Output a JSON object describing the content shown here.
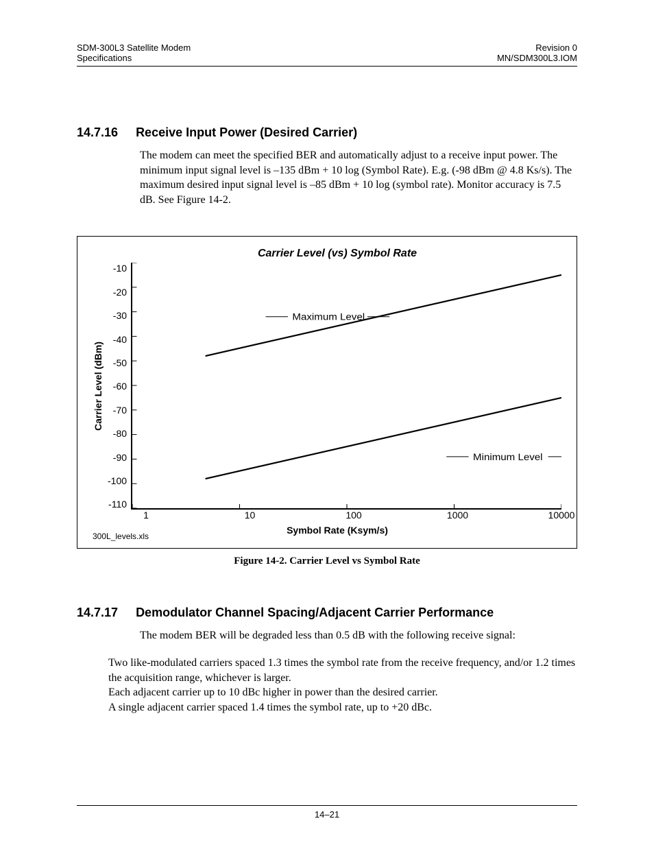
{
  "header": {
    "left_line1": "SDM-300L3 Satellite Modem",
    "left_line2": "Specifications",
    "right_line1": "Revision 0",
    "right_line2": "MN/SDM300L3.IOM"
  },
  "section1": {
    "num": "14.7.16",
    "title": "Receive Input Power (Desired Carrier)",
    "body": "The modem can meet the specified BER and automatically adjust to a receive input power. The minimum input signal level is –135 dBm + 10 log (Symbol Rate). E.g. (-98 dBm @ 4.8 Ks/s). The maximum desired input signal level is –85 dBm + 10 log (symbol rate). Monitor accuracy is   7.5 dB. See Figure 14-2."
  },
  "chart_data": {
    "type": "line",
    "title": "Carrier Level (vs) Symbol Rate",
    "xlabel": "Symbol Rate (Ksym/s)",
    "ylabel": "Carrier Level (dBm)",
    "x_ticks": [
      1,
      10,
      100,
      1000,
      10000
    ],
    "y_ticks": [
      -10,
      -20,
      -30,
      -40,
      -50,
      -60,
      -70,
      -80,
      -90,
      -100,
      -110
    ],
    "x_scale": "log",
    "xlim": [
      1,
      10000
    ],
    "ylim": [
      -110,
      -10
    ],
    "series": [
      {
        "name": "Maximum Level",
        "x": [
          4.8,
          10000
        ],
        "y": [
          -48,
          -15
        ]
      },
      {
        "name": "Minimum Level",
        "x": [
          4.8,
          10000
        ],
        "y": [
          -98,
          -65
        ]
      }
    ],
    "annotations": [
      {
        "text": "Maximum Level",
        "x": 31,
        "y": -32
      },
      {
        "text": "Minimum Level",
        "x": 1500,
        "y": -89
      }
    ],
    "source_file": "300L_levels.xls"
  },
  "figure_caption": "Figure 14-2.  Carrier Level vs Symbol Rate",
  "section2": {
    "num": "14.7.17",
    "title": "Demodulator Channel Spacing/Adjacent Carrier Performance",
    "lead": "The modem BER will be degraded less than 0.5 dB with the following receive signal:",
    "items": [
      "Two like-modulated carriers spaced 1.3 times the symbol rate from the receive frequency, and/or 1.2 times the acquisition range, whichever is larger.",
      "Each adjacent carrier up to 10 dBc higher in power than the desired carrier.",
      "A single adjacent carrier spaced 1.4 times the symbol rate, up to +20 dBc."
    ]
  },
  "page_number": "14–21"
}
